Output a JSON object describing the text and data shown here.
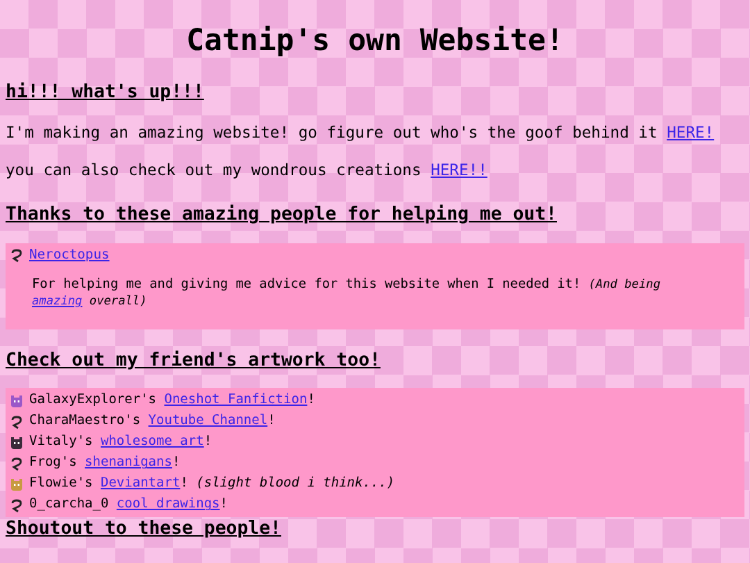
{
  "title": "Catnip's own Website!",
  "intro": {
    "heading": "hi!!! what's up!!!",
    "lines": [
      {
        "text": "I'm making an amazing website! go figure out who's the goof behind it ",
        "link": "HERE!"
      },
      {
        "text": "you can also check out my wondrous creations ",
        "link": "HERE!!"
      }
    ]
  },
  "thanks": {
    "heading": "Thanks to these amazing people for helping me out!",
    "people": [
      {
        "kind": "missing",
        "name": "Neroctopus",
        "text": "For helping me and giving me advice for this website when I needed it! ",
        "note_before": "(And being ",
        "note_link": "amazing",
        "note_after": " overall)"
      }
    ]
  },
  "friends": {
    "heading": "Check out my friend's artwork too!",
    "items": [
      {
        "kind": "avatar",
        "color": "#9a58c8",
        "owner": "GalaxyExplorer's ",
        "link": "Oneshot Fanfiction",
        "after": "!"
      },
      {
        "kind": "missing",
        "owner": "CharaMaestro's ",
        "link": "Youtube Channel",
        "after": "!"
      },
      {
        "kind": "avatar",
        "color": "#3a2a3a",
        "owner": "Vitaly's ",
        "link": "wholesome art",
        "after": "!"
      },
      {
        "kind": "missing",
        "owner": "Frog's ",
        "link": "shenanigans",
        "after": "!"
      },
      {
        "kind": "avatar",
        "color": "#c89a40",
        "owner": "Flowie's ",
        "link": "Deviantart",
        "after": "!",
        "note": " (slight blood i think...)"
      },
      {
        "kind": "missing",
        "owner": "0_carcha_0 ",
        "link": "cool drawings",
        "after": "!"
      }
    ]
  },
  "shoutout": {
    "heading": "Shoutout to these people!"
  }
}
